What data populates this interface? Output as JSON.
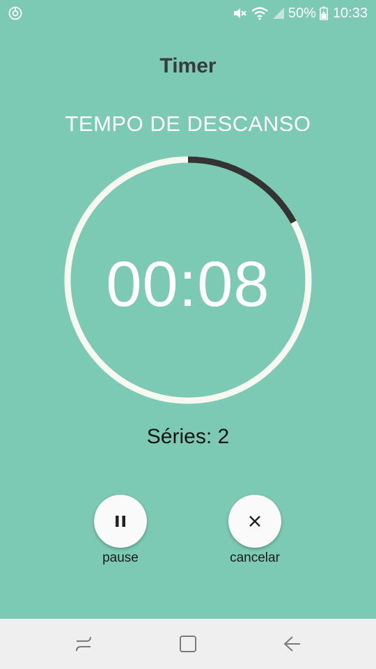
{
  "status_bar": {
    "battery": "50%",
    "time": "10:33",
    "icons": [
      "sync-icon",
      "mute-icon",
      "wifi-icon",
      "signal-icon",
      "battery-icon"
    ]
  },
  "app": {
    "title": "Timer"
  },
  "timer": {
    "phase": "TEMPO DE DESCANSO",
    "time": "00:08",
    "progress": 0.17,
    "colors": {
      "track": "#f7f8ef",
      "progress": "#333333"
    }
  },
  "series": {
    "text": "Séries: 2"
  },
  "actions": {
    "pause_label": "pause",
    "pause_icon": "pause-icon",
    "cancel_label": "cancelar",
    "cancel_icon": "close-icon"
  },
  "nav": {
    "icons": [
      "recent-apps-icon",
      "home-icon",
      "back-icon"
    ]
  },
  "colors": {
    "background": "#7ccab3",
    "title": "#3a3a3a",
    "nav_bar": "#efefef"
  }
}
